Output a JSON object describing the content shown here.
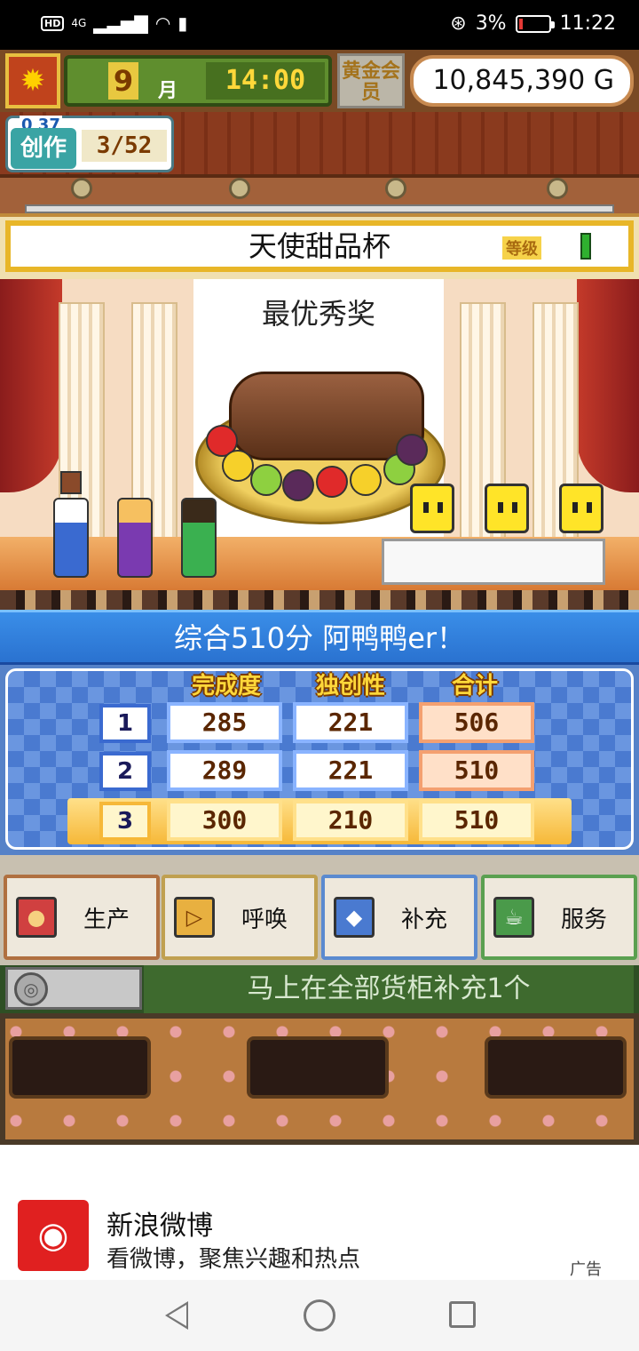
{
  "status_bar": {
    "network": "4G",
    "battery_percent": "3%",
    "time": "11:22"
  },
  "hud": {
    "month_number": "9",
    "month_label": "月",
    "time": "14:00",
    "membership": "黄金会员",
    "money": "10,845,390 G"
  },
  "create": {
    "small_counter": "0 37",
    "label": "创作",
    "count": "3/52"
  },
  "contest": {
    "title": "天使甜品杯",
    "level_label": "等级",
    "award": "最优秀奖"
  },
  "score": {
    "headline": "综合510分 阿鸭鸭er！",
    "columns": [
      "完成度",
      "独创性",
      "合计"
    ],
    "rows": [
      {
        "rank": "1",
        "completion": "285",
        "originality": "221",
        "total": "506"
      },
      {
        "rank": "2",
        "completion": "289",
        "originality": "221",
        "total": "510"
      },
      {
        "rank": "3",
        "completion": "300",
        "originality": "210",
        "total": "510"
      }
    ]
  },
  "actions": [
    {
      "label": "生产",
      "icon": "bread-icon"
    },
    {
      "label": "呼唤",
      "icon": "megaphone-icon"
    },
    {
      "label": "补充",
      "icon": "cake-icon"
    },
    {
      "label": "服务",
      "icon": "coffee-cup-icon"
    }
  ],
  "info": {
    "message": "马上在全部货柜补充1个"
  },
  "ad": {
    "title": "新浪微博",
    "subtitle": "看微博，聚焦兴趣和热点",
    "tag": "广告"
  },
  "colors": {
    "score_header": "#2a72d0",
    "money_border": "#c88a50",
    "banner_border": "#e8b628"
  }
}
